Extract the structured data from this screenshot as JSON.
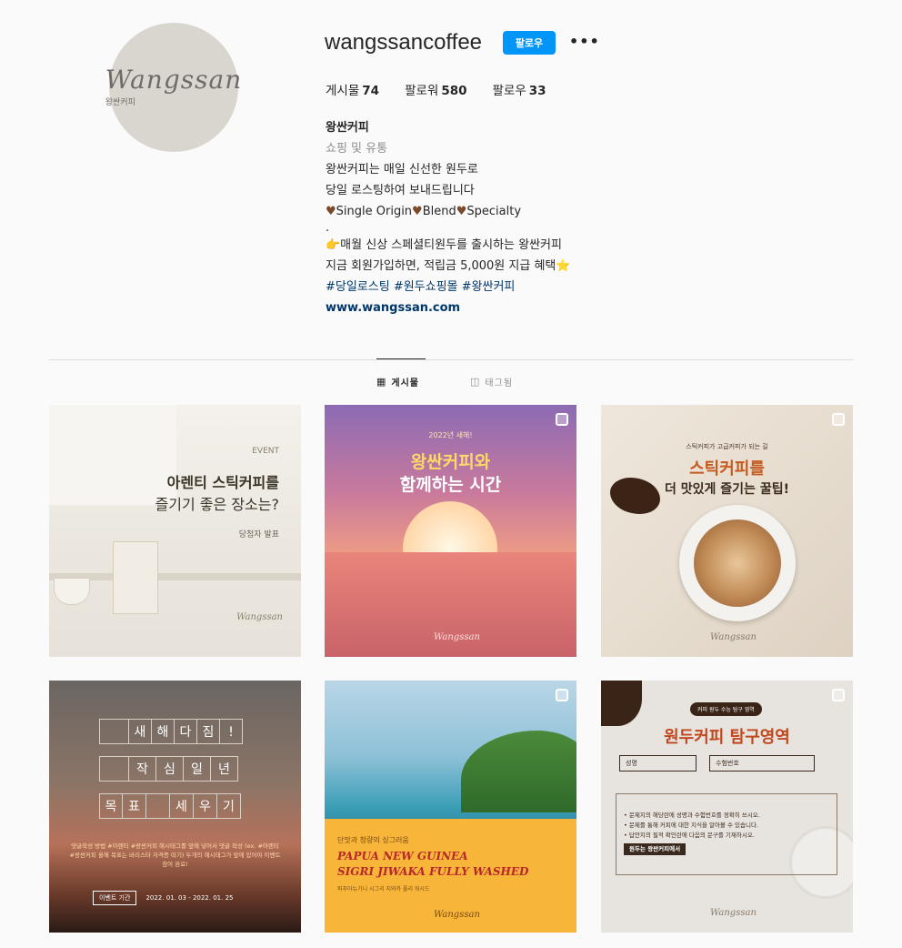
{
  "profile": {
    "avatar_logo": "Wangssan",
    "avatar_sub": "왕싼커피",
    "username": "wangssancoffee",
    "follow_label": "팔로우",
    "more_label": "•••",
    "stats": [
      {
        "label": "게시물",
        "value": "74"
      },
      {
        "label": "팔로워",
        "value": "580"
      },
      {
        "label": "팔로우",
        "value": "33"
      }
    ],
    "name": "왕싼커피",
    "category": "쇼핑 및 유통",
    "bio_lines": [
      "왕싼커피는 매일 신선한 원두로",
      "당일 로스팅하여 보내드립니다"
    ],
    "bio_tags": [
      "Single Origin",
      "Blend",
      "Specialty"
    ],
    "bio_dot": ".",
    "bio_promo": [
      "👉매월 신상 스페셜티원두를 출시하는 왕싼커피",
      "지금 회원가입하면, 적립금 5,000원 지급 혜택⭐",
      "#당일로스팅 #원두쇼핑몰 #왕싼커피"
    ],
    "link": "www.wangssan.com"
  },
  "tabs": [
    {
      "label": "게시물",
      "icon": "grid-icon",
      "active": true
    },
    {
      "label": "태그됨",
      "icon": "tagged-icon",
      "active": false
    }
  ],
  "posts": [
    {
      "event": "EVENT",
      "title_1": "아렌티 스틱커피를",
      "title_2": "즐기기 좋은 장소는?",
      "sub": "당첨자 발표",
      "brand": "Wangssan"
    },
    {
      "pre": "2022년 새해!",
      "title_1": "왕싼커피와",
      "title_2": "함께하는 시간",
      "brand": "Wangssan"
    },
    {
      "pre": "스틱커피가 고급커피가 되는 길",
      "title_1": "스틱커피를",
      "title_2": "더 맛있게 즐기는 꿀팁!",
      "brand": "Wangssan"
    },
    {
      "row_1": [
        "새",
        "해",
        "다",
        "짐",
        "!"
      ],
      "row_2": [
        "작",
        "심",
        "일",
        "년"
      ],
      "row_3": [
        "목",
        "표",
        "세",
        "우",
        "기"
      ],
      "body": "댓글작성 방법 #아렌티 #왕싼커피 해시태그를 앞에 넣어서 댓글 작성 (ex. #아렌티 #왕싼커피 올해 목표는 바리스타 자격증 따기) 두개의 해시태그가 앞에 있어야 이벤트 참여 완료!",
      "period_label": "이벤트 기간",
      "period": "2022. 01. 03 - 2022. 01. 25"
    },
    {
      "pre": "단맛과 청량의 싱그러움",
      "title_1": "PAPUA NEW GUINEA",
      "title_2": "SIGRI JIWAKA FULLY WASHED",
      "sub": "파푸아뉴기니 시그리 지와카 풀리 워시드",
      "brand": "Wangssan"
    },
    {
      "badge": "커피 원두 수능 탐구 영역",
      "title": "원두커피 탐구영역",
      "field_1": "성명",
      "field_2": "수험번호",
      "rules": [
        "• 문제지의 해당란에 성명과 수험번호를 정확히 쓰시오.",
        "• 문제를 통해 커피에 대한 지식을 알아볼 수 있습니다.",
        "• 답안지의 필적 확인란에 다음의 문구를 기재하시오."
      ],
      "answer": "원두는 왕싼커피에서",
      "brand": "Wangssan"
    }
  ],
  "colors": {
    "accent": "#0095f6",
    "link": "#00376b",
    "muted": "#8e8e8e",
    "heart": "#7a4a2a"
  }
}
